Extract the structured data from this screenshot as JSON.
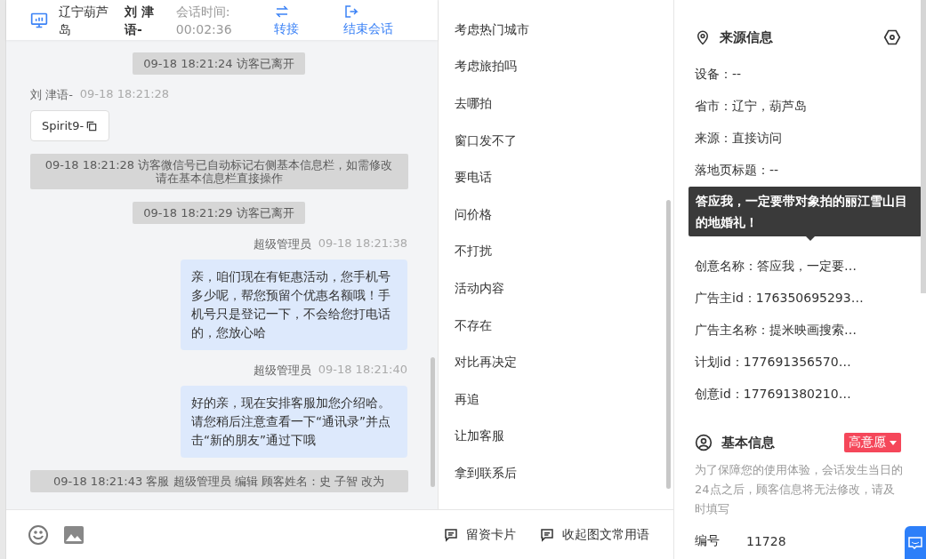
{
  "header": {
    "location": "辽宁葫芦岛",
    "visitor": "刘 津语-",
    "session_label": "会话时间:",
    "session_time": "00:02:36",
    "actions": [
      {
        "kind": "transfer",
        "label": "转接"
      },
      {
        "kind": "end",
        "label": "结束会话"
      }
    ]
  },
  "messages": [
    {
      "kind": "system",
      "text": "09-18 18:21:24 访客已离开"
    },
    {
      "kind": "incoming",
      "name": "刘 津语-",
      "time": "09-18 18:21:28",
      "card": "Spirit9-"
    },
    {
      "kind": "system",
      "text": "09-18 18:21:28 访客微信号已自动标记右侧基本信息栏，如需修改请在基本信息栏直接操作",
      "wide": true
    },
    {
      "kind": "system",
      "text": "09-18 18:21:29 访客已离开"
    },
    {
      "kind": "outgoing",
      "name": "超级管理员",
      "time": "09-18 18:21:38",
      "text": "亲，咱们现在有钜惠活动，您手机号多少呢，帮您预留个优惠名额哦！手机号只是登记一下，不会给您打电话的，您放心哈"
    },
    {
      "kind": "outgoing",
      "name": "超级管理员",
      "time": "09-18 18:21:40",
      "text": "好的亲，现在安排客服加您介绍哈。请您稍后注意查看一下“通讯录”并点击“新的朋友”通过下哦"
    },
    {
      "kind": "system",
      "text": "09-18 18:21:43 客服 超级管理员 编辑 顾客姓名：史 子智 改为",
      "wide": true
    }
  ],
  "quick_replies": [
    "考虑热门城市",
    "考虑旅拍吗",
    "去哪拍",
    "窗口发不了",
    "要电话",
    "问价格",
    "不打扰",
    "活动内容",
    "不存在",
    "对比再决定",
    "再追",
    "让加客服",
    "拿到联系后"
  ],
  "toolbar": {
    "tools": [
      {
        "kind": "emoji"
      },
      {
        "kind": "image"
      }
    ],
    "actions": [
      "留资卡片",
      "收起图文常用语"
    ]
  },
  "source_info": {
    "title": "来源信息",
    "fields_above": [
      "设备：--",
      "省市：辽宁，葫芦岛",
      "来源：直接访问",
      "落地页标题：--"
    ],
    "fields_below": [
      "创意名称：答应我，一定要…",
      "广告主id：176350695293…",
      "广告主名称：提米映画搜索…",
      "计划id：177691356570…",
      "创意id：177691380210…"
    ],
    "tooltip": "答应我，一定要带对象拍的丽江雪山目的地婚礼！"
  },
  "basic_info": {
    "title": "基本信息",
    "intent": "高意愿",
    "notice": "为了保障您的使用体验，会话发生当日的24点之后，顾客信息将无法修改，请及时填写",
    "fields": [
      {
        "label": "编号",
        "value": "11728"
      }
    ]
  }
}
